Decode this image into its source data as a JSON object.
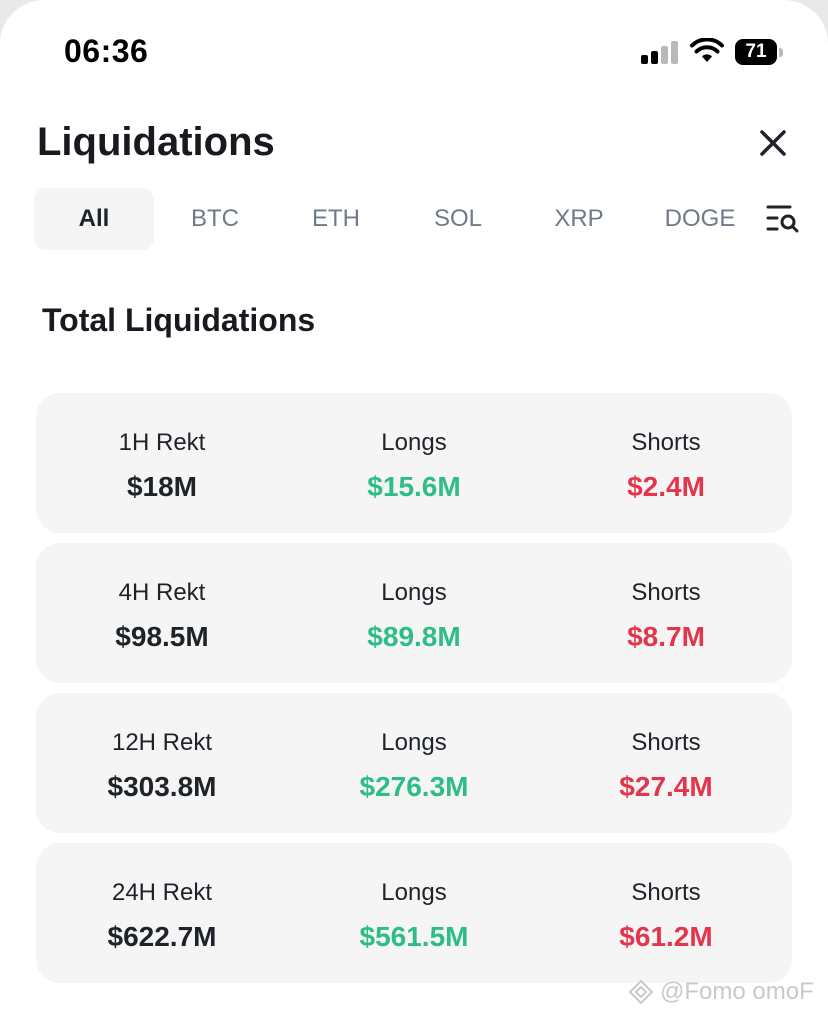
{
  "status_bar": {
    "time": "06:36",
    "battery": "71"
  },
  "header": {
    "title": "Liquidations"
  },
  "tabs": [
    "All",
    "BTC",
    "ETH",
    "SOL",
    "XRP",
    "DOGE"
  ],
  "active_tab": "All",
  "section": {
    "title": "Total Liquidations"
  },
  "rows": [
    {
      "period": "1H  Rekt",
      "total": "$18M",
      "longs_label": "Longs",
      "longs": "$15.6M",
      "shorts_label": "Shorts",
      "shorts": "$2.4M"
    },
    {
      "period": "4H Rekt",
      "total": "$98.5M",
      "longs_label": "Longs",
      "longs": "$89.8M",
      "shorts_label": "Shorts",
      "shorts": "$8.7M"
    },
    {
      "period": "12H Rekt",
      "total": "$303.8M",
      "longs_label": "Longs",
      "longs": "$276.3M",
      "shorts_label": "Shorts",
      "shorts": "$27.4M"
    },
    {
      "period": "24H Rekt",
      "total": "$622.7M",
      "longs_label": "Longs",
      "longs": "$561.5M",
      "shorts_label": "Shorts",
      "shorts": "$61.2M"
    }
  ],
  "watermark": "@Fomo omoF",
  "colors": {
    "long": "#2ebd85",
    "short": "#e2364c",
    "card_bg": "#f5f5f5",
    "text": "#1e2329",
    "muted": "#707a8a"
  }
}
